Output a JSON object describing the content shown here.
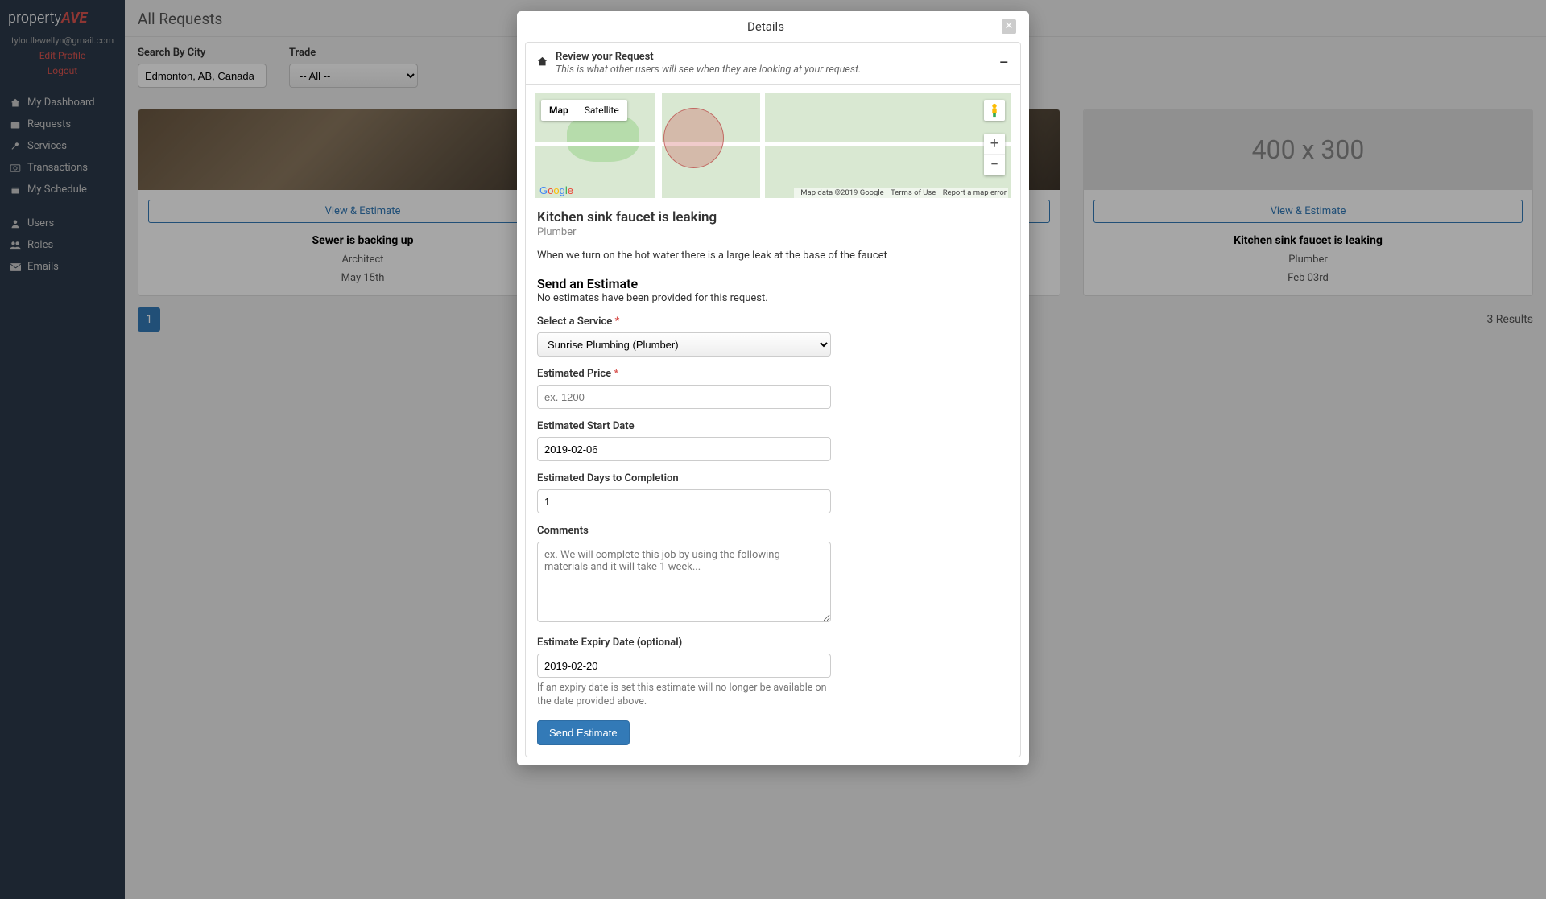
{
  "sidebar": {
    "logo_text": "property",
    "logo_suffix": "AVE",
    "user_email": "tylor.llewellyn@gmail.com",
    "edit_profile": "Edit Profile",
    "logout": "Logout",
    "nav1": [
      {
        "label": "My Dashboard",
        "icon": "home"
      },
      {
        "label": "Requests",
        "icon": "inbox"
      },
      {
        "label": "Services",
        "icon": "wrench"
      },
      {
        "label": "Transactions",
        "icon": "money"
      },
      {
        "label": "My Schedule",
        "icon": "calendar"
      }
    ],
    "nav2": [
      {
        "label": "Users",
        "icon": "user"
      },
      {
        "label": "Roles",
        "icon": "users"
      },
      {
        "label": "Emails",
        "icon": "envelope"
      }
    ]
  },
  "main": {
    "title": "All Requests",
    "filters": {
      "city_label": "Search By City",
      "city_value": "Edmonton, AB, Canada",
      "trade_label": "Trade",
      "trade_value": "-- All --"
    },
    "cards": [
      {
        "title": "Sewer is backing up",
        "sub": "Architect",
        "date": "May 15th",
        "button": "View & Estimate",
        "img": "photo1",
        "placeholder": ""
      },
      {
        "title": "",
        "sub": "",
        "date": "",
        "button": "View & Estimate",
        "img": "photo1",
        "placeholder": ""
      },
      {
        "title": "Kitchen sink faucet is leaking",
        "sub": "Plumber",
        "date": "Feb 03rd",
        "button": "View & Estimate",
        "img": "placeholder",
        "placeholder": "400 x 300"
      }
    ],
    "page_number": "1",
    "result_count": "3 Results"
  },
  "modal": {
    "title": "Details",
    "panel_title": "Review your Request",
    "panel_sub": "This is what other users will see when they are looking at your request.",
    "map": {
      "tab_map": "Map",
      "tab_satellite": "Satellite",
      "attr_data": "Map data ©2019 Google",
      "attr_terms": "Terms of Use",
      "attr_report": "Report a map error"
    },
    "detail": {
      "title": "Kitchen sink faucet is leaking",
      "trade": "Plumber",
      "desc": "When we turn on the hot water there is a large leak at the base of the faucet"
    },
    "estimate": {
      "title": "Send an Estimate",
      "none_msg": "No estimates have been provided for this request.",
      "service_label": "Select a Service ",
      "service_value": "Sunrise Plumbing (Plumber)",
      "price_label": "Estimated Price ",
      "price_placeholder": "ex. 1200",
      "start_label": "Estimated Start Date",
      "start_value": "2019-02-06",
      "days_label": "Estimated Days to Completion",
      "days_value": "1",
      "comments_label": "Comments",
      "comments_placeholder": "ex. We will complete this job by using the following materials and it will take 1 week...",
      "expiry_label": "Estimate Expiry Date (optional)",
      "expiry_value": "2019-02-20",
      "expiry_help": "If an expiry date is set this estimate will no longer be available on the date provided above.",
      "send_button": "Send Estimate"
    }
  }
}
